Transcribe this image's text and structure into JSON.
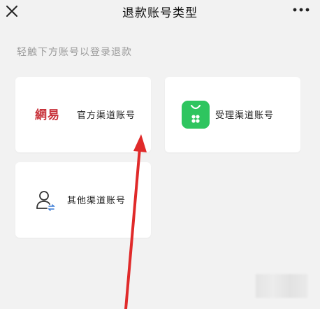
{
  "header": {
    "close_icon": "close-icon",
    "title": "退款账号类型",
    "more_icon": "more-dots-icon"
  },
  "hint": "轻触下方账号以登录退款",
  "cards": {
    "official": {
      "logo_text": "網易",
      "label": "官方渠道账号"
    },
    "agent": {
      "icon": "green-bag-app-icon",
      "label": "受理渠道账号"
    },
    "other": {
      "icon": "user-switch-icon",
      "label": "其他渠道账号"
    }
  },
  "annotation": {
    "arrow_color": "#e02a2a"
  },
  "colors": {
    "background": "#f2f2f2",
    "card": "#ffffff",
    "brand_red": "#c8323a",
    "app_green": "#2ec55f",
    "hint_gray": "#9b9b9b"
  }
}
